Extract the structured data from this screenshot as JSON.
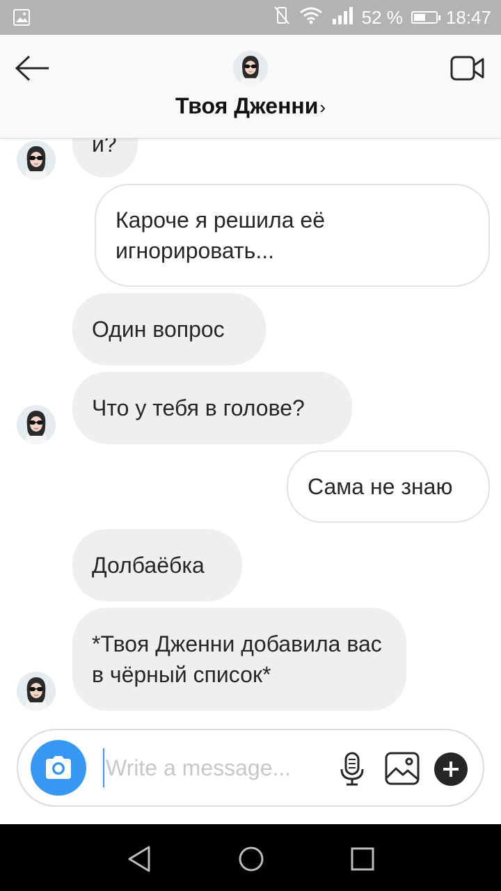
{
  "status_bar": {
    "battery": "52 %",
    "battery_level": 0.52,
    "time": "18:47",
    "icons": [
      "gallery-icon",
      "no-vibrate-icon",
      "wifi-icon",
      "signal-icon",
      "battery-icon"
    ]
  },
  "header": {
    "title": "Твоя Дженни",
    "chevron": "›",
    "icons": [
      "back-arrow-icon",
      "video-call-icon"
    ]
  },
  "messages": [
    {
      "side": "in",
      "text": "и?"
    },
    {
      "side": "out",
      "text": "Кароче я решила её игнорировать..."
    },
    {
      "side": "in",
      "text": "Один вопрос"
    },
    {
      "side": "in",
      "text": "Что у тебя в голове?"
    },
    {
      "side": "out",
      "text": "Сама не знаю"
    },
    {
      "side": "in",
      "text": "Долбаёбка"
    },
    {
      "side": "in",
      "text": "*Твоя Дженни добавила вас в чёрный список*"
    }
  ],
  "composer": {
    "placeholder": "Write a message...",
    "value": "",
    "icons": [
      "camera-icon",
      "microphone-icon",
      "gallery-icon",
      "plus-icon"
    ]
  },
  "nav_bar": {
    "icons": [
      "back-triangle-icon",
      "home-circle-icon",
      "recents-square-icon"
    ]
  },
  "colors": {
    "accent": "#3897f0",
    "incoming_bubble": "#efefef",
    "outgoing_border": "#e2e2e2",
    "status_bar": "#b3b3b3"
  }
}
